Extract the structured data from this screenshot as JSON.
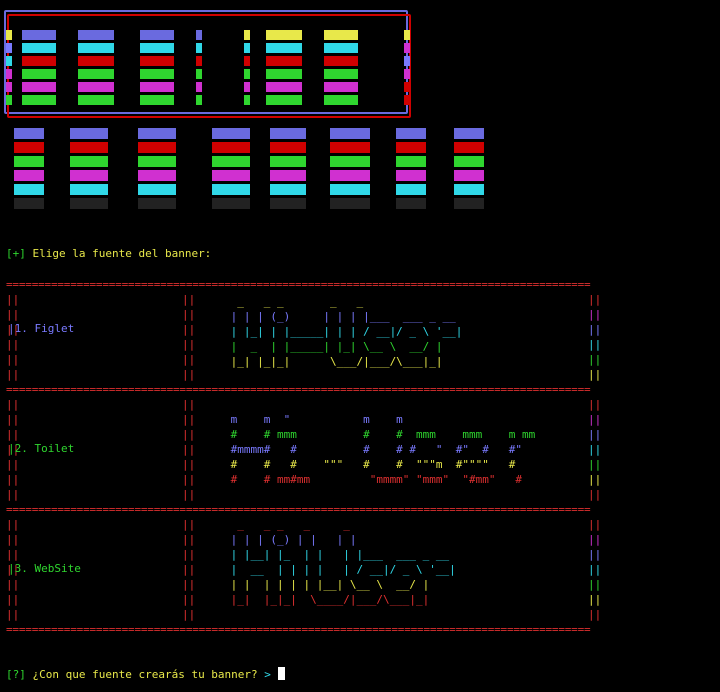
{
  "prompt_choose": {
    "marker": "[+]",
    "text": "Elige la fuente del banner:"
  },
  "separator": "===========================================================================================",
  "options": [
    {
      "label": "|1. Figlet",
      "art": [
        "  _   _ _       _   _",
        " | | | (_)     | | | |___  ___ _ __",
        " | |_| | |_____| | | / __|/ _ \\ '__|",
        " |  _  | |_____| |_| \\__ \\  __/ |",
        " |_| |_|_|      \\___/|___/\\___|_|"
      ]
    },
    {
      "label": "|2. Toilet",
      "art": [
        " m    m  \"           m    m",
        " #    # mmm          #    #  mmm    mmm    m mm",
        " #mmmm#   #          #    # #   \"  #\"  #   #\"",
        " #    #   #    \"\"\"   #    #  \"\"\"m  #\"\"\"\"   #",
        " #    # mm#mm         \"mmmm\" \"mmm\"  \"#mm\"   #"
      ]
    },
    {
      "label": "|3. WebSite",
      "art": [
        "  _   _ _   _     _",
        " | | | (_) | |   | |",
        " | |__| |_  | |   | |___  ___ _ __",
        " |  __  | | | |   | / __|/ _ \\ '__|",
        " | |  | | | | |__| \\__ \\  __/ |",
        " |_|  |_|_|  \\____/|___/\\___|_|"
      ]
    }
  ],
  "prompt_ask": {
    "marker": "[?]",
    "text": "¿Con que fuente crearás tu banner?",
    "arrow": ">"
  },
  "colors": {
    "red": "#e03030",
    "green": "#2fd62f",
    "yellow": "#e8e84a",
    "blue": "#7a7aff",
    "cyan": "#30d8e8",
    "magenta": "#d030d0"
  }
}
